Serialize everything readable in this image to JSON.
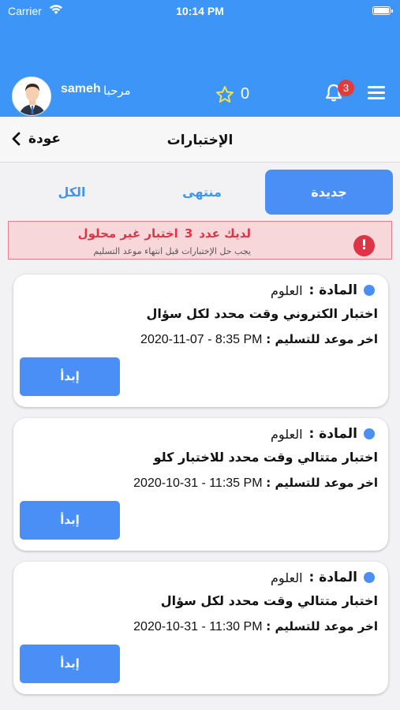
{
  "status_bar": {
    "carrier": "Carrier",
    "time": "10:14 PM"
  },
  "header": {
    "username": "sameh",
    "greeting": "مرحبا",
    "points": "0",
    "notifications_count": "3",
    "color": "#3d95f7"
  },
  "nav": {
    "title": "الإختبارات",
    "back_label": "عودة"
  },
  "tabs": [
    {
      "label": "جديدة",
      "active": true
    },
    {
      "label": "منتهى",
      "active": false
    },
    {
      "label": "الكل",
      "active": false
    }
  ],
  "alert": {
    "prefix": "لديك عدد",
    "count": "3",
    "suffix": "اختبار غير محلول",
    "subtext": "يجب حل الإختبارات قبل انتهاء موعد التسليم",
    "icon": "!"
  },
  "exams": [
    {
      "subject_label": "المادة :",
      "subject": "العلوم",
      "title": "اختبار الكتروني وقت محدد لكل سؤال",
      "deadline_label": "اخر موعد للتسليم :",
      "deadline": "2020-11-07  -  8:35 PM",
      "button": "إبدأ"
    },
    {
      "subject_label": "المادة :",
      "subject": "العلوم",
      "title": "اختبار متتالي وقت محدد للاختبار كلو",
      "deadline_label": "اخر موعد للتسليم :",
      "deadline": "2020-10-31  -  11:35 PM",
      "button": "إبدأ"
    },
    {
      "subject_label": "المادة :",
      "subject": "العلوم",
      "title": "اختبار متتالي   وقت محدد لكل سؤال",
      "deadline_label": "اخر موعد للتسليم :",
      "deadline": "2020-10-31  -  11:30 PM",
      "button": "إبدأ"
    }
  ],
  "colors": {
    "primary": "#4a8ff5",
    "alert_bg": "#f8d7da",
    "alert_text": "#dc3545"
  },
  "icons": {
    "wifi": "wifi-icon",
    "avatar": "user-avatar",
    "star": "star-icon",
    "bell": "bell-icon",
    "menu": "hamburger-menu-icon",
    "back": "chevron-left-icon",
    "alert": "exclamation-circle-icon"
  }
}
